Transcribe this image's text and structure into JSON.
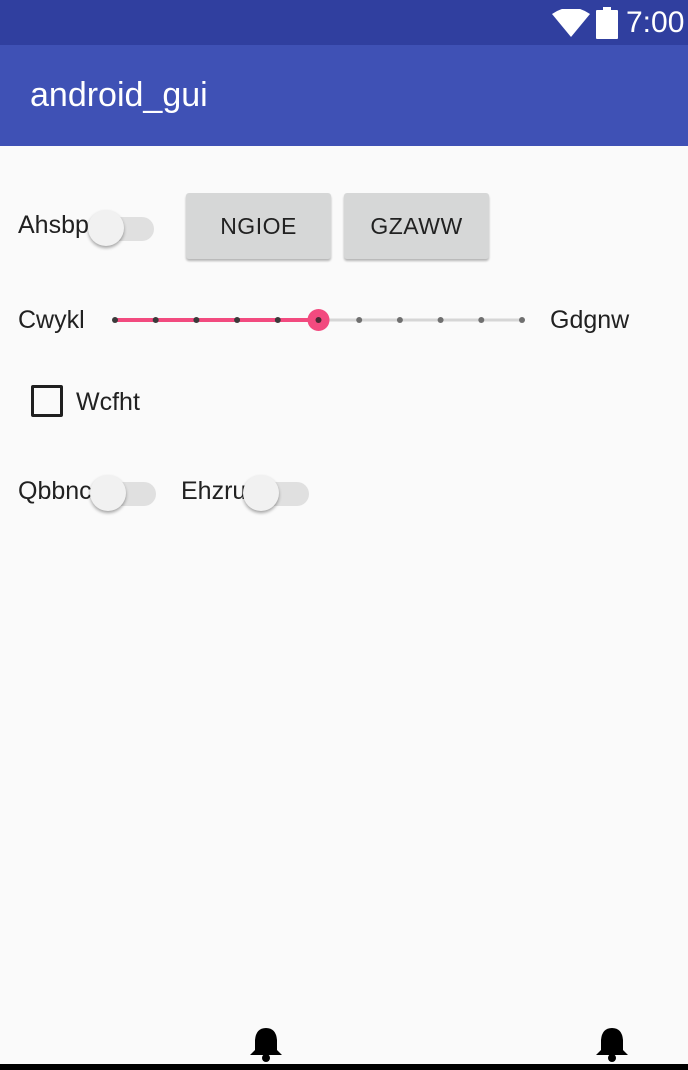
{
  "status_bar": {
    "time": "7:00",
    "icons": [
      "wifi-icon",
      "battery-icon"
    ],
    "color": "#303f9f"
  },
  "app_bar": {
    "title": "android_gui",
    "color": "#3f51b5"
  },
  "row1": {
    "switch_label": "Ahsbp",
    "switch_on": false,
    "button1": "NGIOE",
    "button2": "GZAWW"
  },
  "seekbar": {
    "left_label": "Cwykl",
    "right_label": "Gdgnw",
    "steps": 10,
    "value": 5,
    "accent": "#f24a7f"
  },
  "checkbox": {
    "label": "Wcfht",
    "checked": false
  },
  "row4": {
    "switch1_label": "Qbbnc",
    "switch1_on": false,
    "switch2_label": "Ehzru",
    "switch2_on": false
  },
  "bottom": {
    "icons": [
      "bell-icon",
      "bell-icon"
    ]
  }
}
